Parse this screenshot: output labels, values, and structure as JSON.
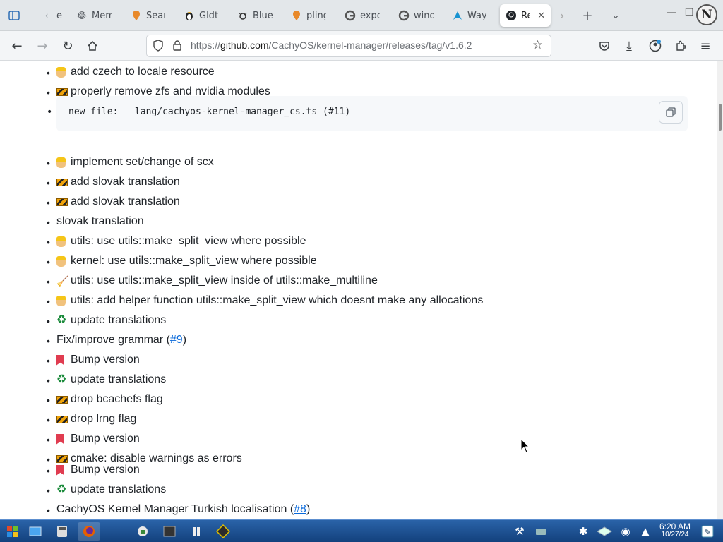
{
  "tabs": [
    {
      "label": "",
      "icon": "sidebar-icon"
    },
    {
      "label": "e",
      "icon": "arrow-left-icon"
    },
    {
      "label": "Mem",
      "icon": "laugh-emoji-icon"
    },
    {
      "label": "Sear",
      "icon": "search-location-icon"
    },
    {
      "label": "Gldt",
      "icon": "linux-penguin-icon"
    },
    {
      "label": "Blue",
      "icon": "bug-icon"
    },
    {
      "label": "pling",
      "icon": "location-pin-icon"
    },
    {
      "label": "expo",
      "icon": "google-icon"
    },
    {
      "label": "wind",
      "icon": "google-icon"
    },
    {
      "label": "Way",
      "icon": "arch-icon"
    },
    {
      "label": "Re",
      "icon": "github-icon"
    }
  ],
  "url": {
    "prefix": "https://",
    "host": "github.com",
    "path": "/CachyOS/kernel-manager/releases/tag/v1.6.2"
  },
  "code": {
    "text": "new file:   lang/cachyos-kernel-manager_cs.ts (#11)"
  },
  "items": [
    {
      "emoji": "worker",
      "text": "add czech to locale resource"
    },
    {
      "emoji": "barrier",
      "text": "properly remove zfs and nvidia modules"
    },
    {
      "emoji": "worker",
      "text": "implement set/change of scx"
    },
    {
      "emoji": "barrier",
      "text": "add slovak translation"
    },
    {
      "emoji": "barrier",
      "text": "add slovak translation"
    },
    {
      "emoji": "",
      "text": "slovak translation"
    },
    {
      "emoji": "worker",
      "text": "utils: use utils::make_split_view where possible"
    },
    {
      "emoji": "worker",
      "text": "kernel: use utils::make_split_view where possible"
    },
    {
      "emoji": "broom",
      "text": "utils: use utils::make_split_view inside of utils::make_multiline"
    },
    {
      "emoji": "worker",
      "text": "utils: add helper function utils::make_split_view which doesnt make any allocations"
    },
    {
      "emoji": "recycle",
      "text": "update translations"
    },
    {
      "emoji": "",
      "text": "Fix/improve grammar (",
      "link": "#9",
      "after": ")"
    },
    {
      "emoji": "bookmark",
      "text": "Bump version"
    },
    {
      "emoji": "recycle",
      "text": "update translations"
    },
    {
      "emoji": "barrier",
      "text": "drop bcachefs flag"
    },
    {
      "emoji": "barrier",
      "text": "drop lrng flag"
    },
    {
      "emoji": "bookmark",
      "text": "Bump version"
    },
    {
      "emoji": "barrier",
      "text": "cmake: disable warnings as errors"
    },
    {
      "emoji": "bookmark",
      "text": "Bump version"
    },
    {
      "emoji": "recycle",
      "text": "update translations"
    },
    {
      "emoji": "",
      "text": "CachyOS Kernel Manager Turkish localisation (",
      "link": "#8",
      "after": ")"
    }
  ],
  "clock": {
    "time": "6:20 AM",
    "date": "10/27/24"
  },
  "colors": {
    "link": "#0969da",
    "text": "#1f2328",
    "taskbar": "#1d4f8f"
  }
}
